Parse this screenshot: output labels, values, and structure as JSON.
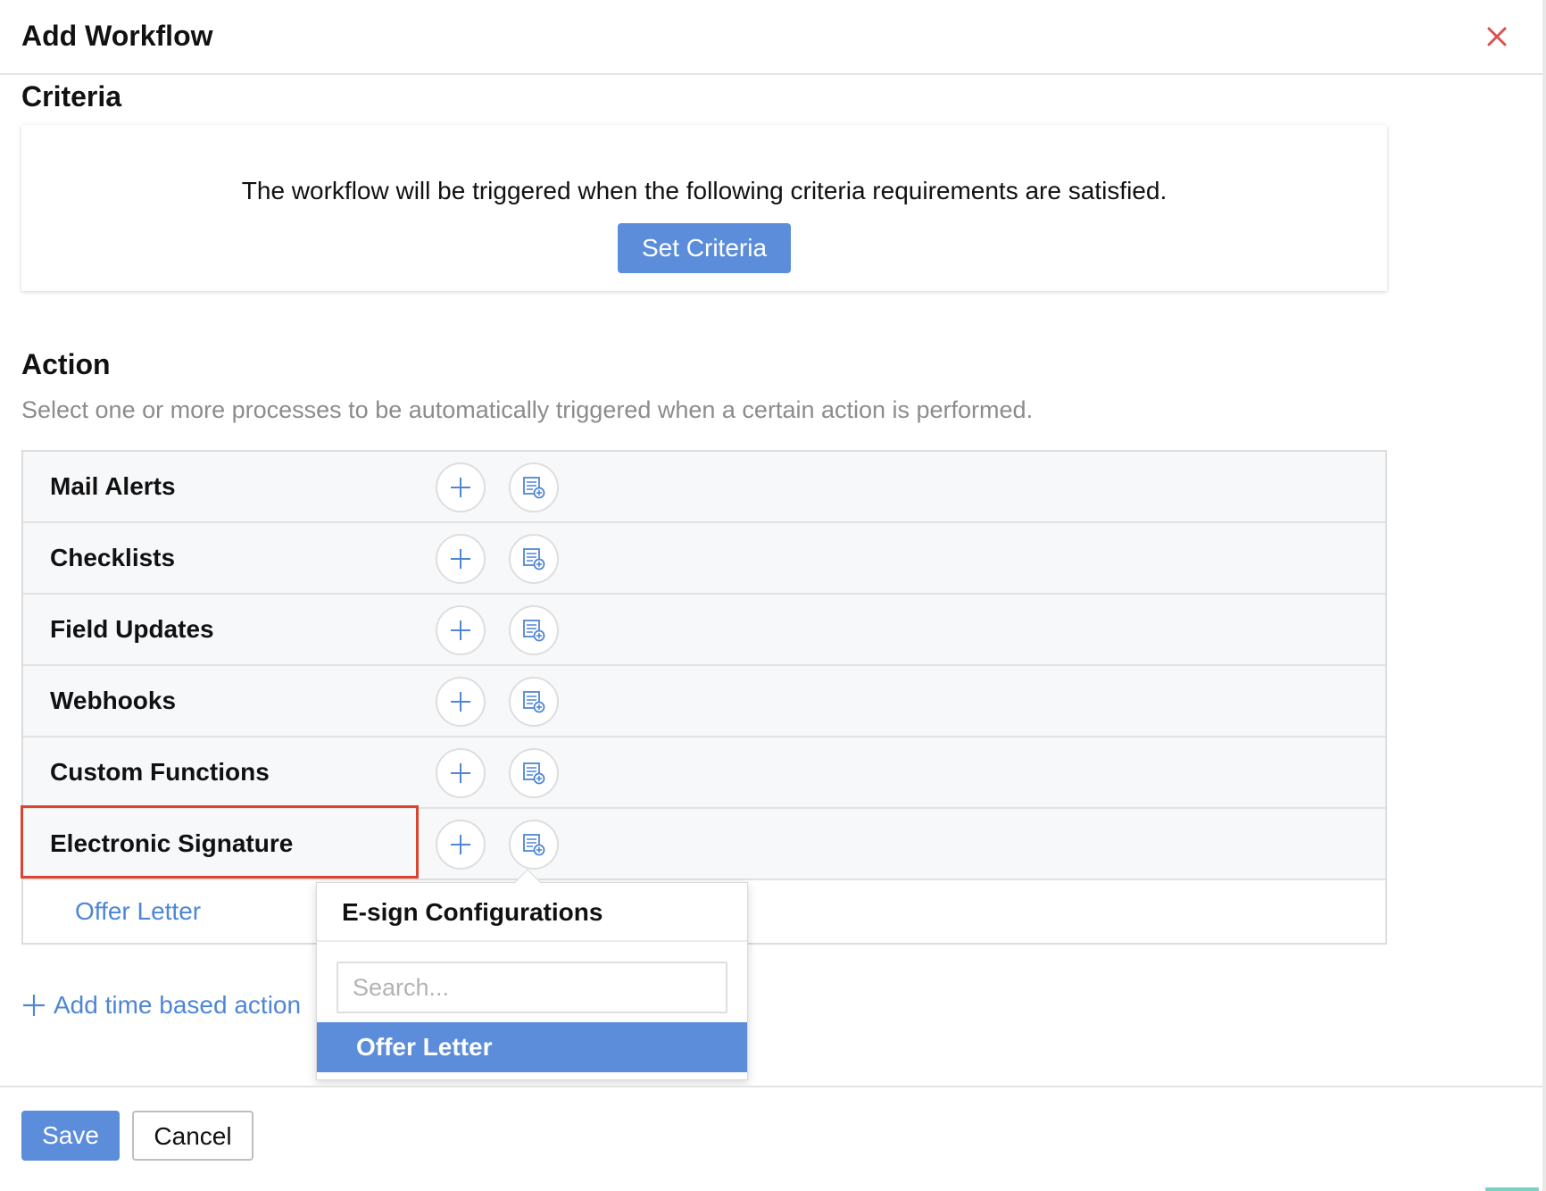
{
  "header": {
    "title": "Add Workflow",
    "close_icon": "close-icon"
  },
  "criteria": {
    "title": "Criteria",
    "description": "The workflow will be triggered when the following criteria requirements are satisfied.",
    "button_label": "Set Criteria"
  },
  "action": {
    "title": "Action",
    "description": "Select one or more processes to be automatically triggered when a certain action is performed.",
    "rows": [
      {
        "label": "Mail Alerts"
      },
      {
        "label": "Checklists"
      },
      {
        "label": "Field Updates"
      },
      {
        "label": "Webhooks"
      },
      {
        "label": "Custom Functions"
      },
      {
        "label": "Electronic Signature"
      }
    ],
    "selected_item": "Offer Letter",
    "add_time_based_label": "Add time based action"
  },
  "dropdown": {
    "title": "E-sign Configurations",
    "search_placeholder": "Search...",
    "options": [
      "Offer Letter"
    ]
  },
  "footer": {
    "save_label": "Save",
    "cancel_label": "Cancel"
  },
  "colors": {
    "primary": "#5b8ddb",
    "link": "#4e86d6",
    "highlight": "#d9452f",
    "close": "#d9534f"
  }
}
